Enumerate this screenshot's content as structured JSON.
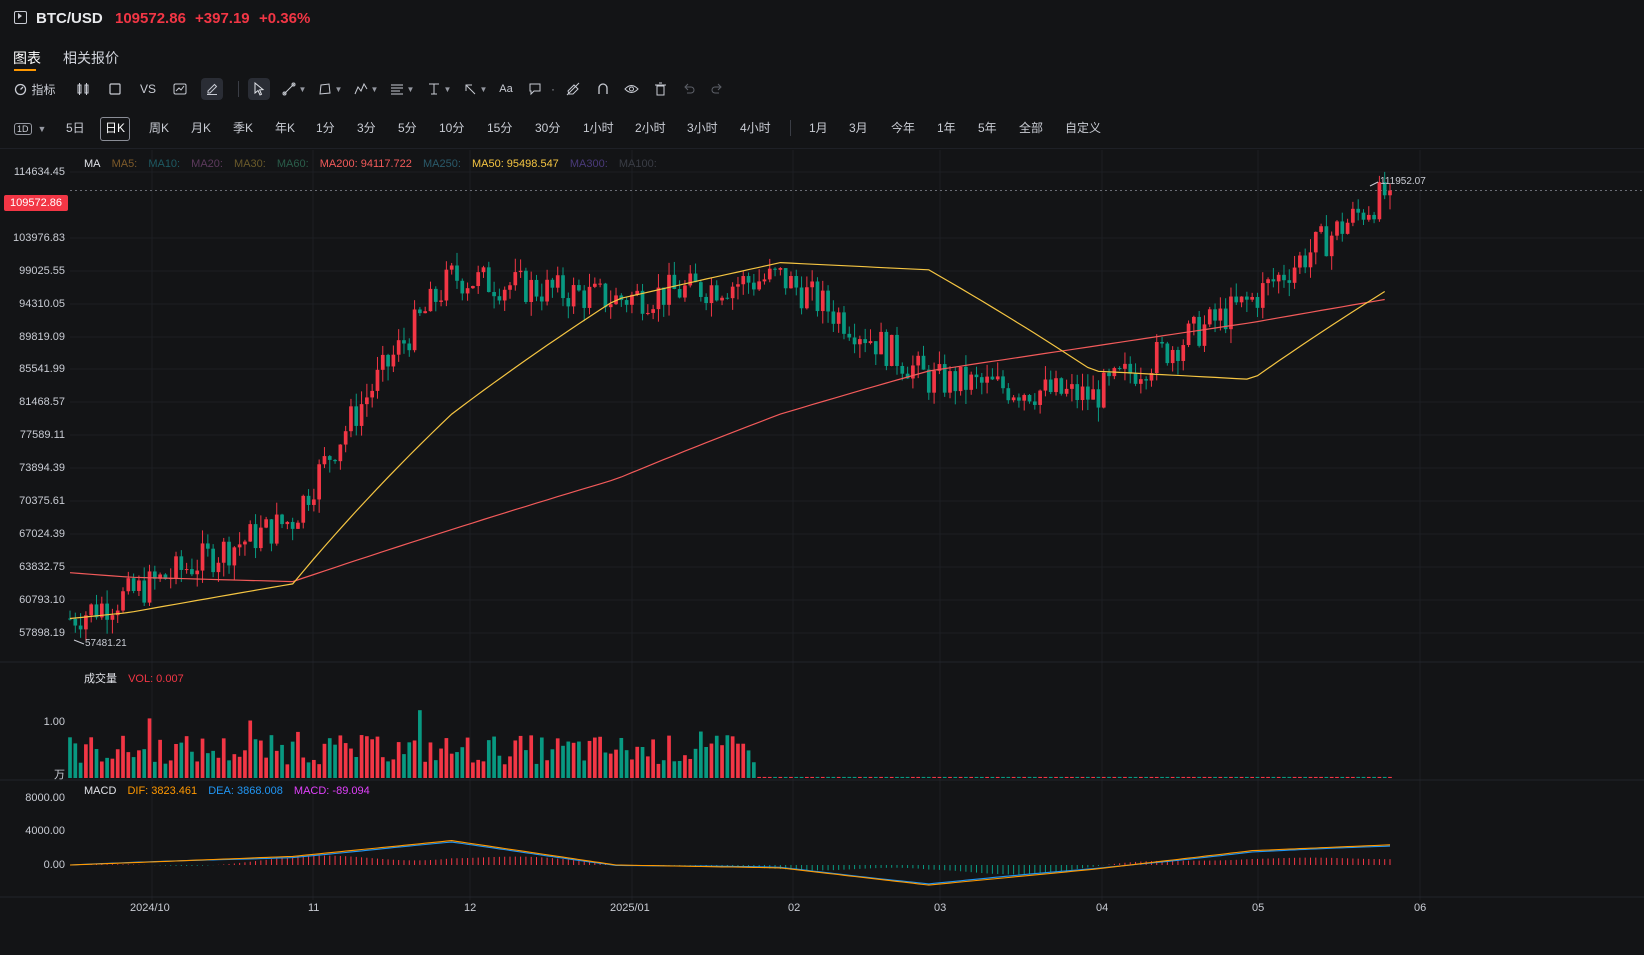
{
  "header": {
    "symbol": "BTC/USD",
    "price": "109572.86",
    "change": "+397.19",
    "change_pct": "+0.36%",
    "up_color": "#f23645",
    "down_color": "#089981"
  },
  "tabs": [
    {
      "label": "图表"
    },
    {
      "label": "相关报价"
    }
  ],
  "toolbar": {
    "indicators_label": "指标",
    "vs_label": "VS",
    "icons": [
      "candle-type-icon",
      "square-icon",
      "compare-icon",
      "chart-style-icon",
      "pencil-icon",
      "cursor-icon",
      "line-tool-icon",
      "shape-tool-icon",
      "pattern-tool-icon",
      "fib-tool-icon",
      "measure-tool-icon",
      "arrow-tool-icon",
      "text-tool-icon",
      "comment-icon",
      "eraser-icon",
      "magnet-icon",
      "eye-icon",
      "trash-icon",
      "undo-icon",
      "redo-icon"
    ],
    "text_tool_label": "Aa"
  },
  "timeframes": {
    "dropdown_label": "1D",
    "items": [
      "5日",
      "日K",
      "周K",
      "月K",
      "季K",
      "年K",
      "1分",
      "3分",
      "5分",
      "10分",
      "15分",
      "30分",
      "1小时",
      "2小时",
      "3小时",
      "4小时"
    ],
    "active": "日K",
    "ranges": [
      "1月",
      "3月",
      "今年",
      "1年",
      "5年",
      "全部",
      "自定义"
    ]
  },
  "price_axis": {
    "labels": [
      "114634.45",
      "103976.83",
      "99025.55",
      "94310.05",
      "89819.09",
      "85541.99",
      "81468.57",
      "77589.11",
      "73894.39",
      "70375.61",
      "67024.39",
      "63832.75",
      "60793.10",
      "57898.19"
    ],
    "last_price_badge": "109572.86",
    "high_label": "111952.07",
    "low_label": "57481.21"
  },
  "ma_legend": {
    "title": "MA",
    "items": [
      {
        "label": "MA5:",
        "color": "#7d5a2a"
      },
      {
        "label": "MA10:",
        "color": "#1e5a63"
      },
      {
        "label": "MA20:",
        "color": "#5d3a5d"
      },
      {
        "label": "MA30:",
        "color": "#6a5a2a"
      },
      {
        "label": "MA60:",
        "color": "#2a5d4a"
      },
      {
        "label": "MA200: 94117.722",
        "color": "#f25a5a"
      },
      {
        "label": "MA250:",
        "color": "#2a5a6a"
      },
      {
        "label": "MA50: 95498.547",
        "color": "#f5c542"
      },
      {
        "label": "MA300:",
        "color": "#4a3a7a"
      },
      {
        "label": "MA100:",
        "color": "#3a3d45"
      }
    ]
  },
  "volume": {
    "title": "成交量",
    "value_label": "VOL: 0.007",
    "axis_labels": [
      "1.00",
      "万"
    ]
  },
  "macd": {
    "title": "MACD",
    "dif_label": "DIF: 3823.461",
    "dea_label": "DEA: 3868.008",
    "macd_label": "MACD: -89.094",
    "dif_color": "#ff9800",
    "dea_color": "#2196f3",
    "macd_color": "#e040fb",
    "axis_labels": [
      "8000.00",
      "4000.00",
      "0.00"
    ]
  },
  "x_axis": [
    "2024/10",
    "11",
    "12",
    "2025/01",
    "02",
    "03",
    "04",
    "05",
    "06"
  ],
  "chart_data": {
    "type": "candlestick",
    "x": [
      "2024-09-20",
      "2024-10-01",
      "2024-11-01",
      "2024-12-01",
      "2025-01-01",
      "2025-02-01",
      "2025-03-01",
      "2025-04-01",
      "2025-05-01",
      "2025-05-27"
    ],
    "close": [
      60000,
      62000,
      69000,
      97000,
      94000,
      97000,
      84000,
      82000,
      94000,
      109572.86
    ],
    "ma50": [
      60000,
      60500,
      63000,
      80000,
      94000,
      99000,
      98000,
      85000,
      84000,
      95498.547
    ],
    "ma200": [
      64000,
      63600,
      63200,
      68000,
      73000,
      80000,
      85000,
      88000,
      91000,
      94117.722
    ],
    "high": 111952.07,
    "low": 57481.21,
    "ylim": [
      57000,
      116000
    ]
  }
}
